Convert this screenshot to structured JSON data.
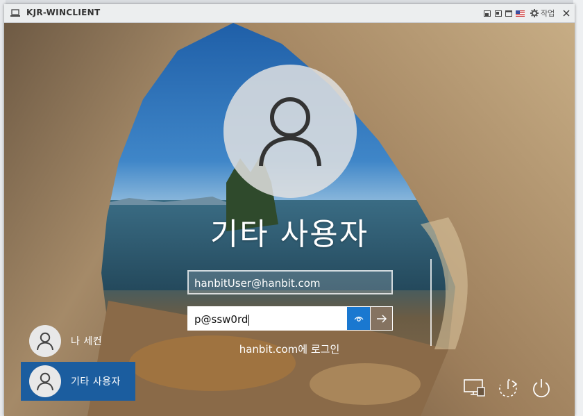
{
  "window": {
    "title": "KJR-WINCLIENT",
    "app_icon": "laptop-icon",
    "controls": [
      "fit-window-icon",
      "multi-monitor-icon",
      "window-icon",
      "us-flag-icon"
    ],
    "work_menu_icon": "gear-icon",
    "work_menu_label": "작업",
    "close_icon": "close-icon"
  },
  "login": {
    "avatar_icon": "user-avatar-icon",
    "user_name": "기타 사용자",
    "username_value": "hanbitUser@hanbit.com",
    "password_value": "p@ssw0rd",
    "reveal_icon": "eye-icon",
    "submit_icon": "arrow-right-icon",
    "sign_in_to": "hanbit.com에 로그인"
  },
  "user_tiles": [
    {
      "label": "나 세컨",
      "icon": "user-avatar-icon",
      "selected": false
    },
    {
      "label": "기타 사용자",
      "icon": "user-avatar-icon",
      "selected": true
    }
  ],
  "bottom_icons": [
    "network-icon",
    "accessibility-icon",
    "power-icon"
  ],
  "colors": {
    "accent": "#1a78d0",
    "selected_tile": "#1b5d9f",
    "titlebar": "#eceeef"
  }
}
